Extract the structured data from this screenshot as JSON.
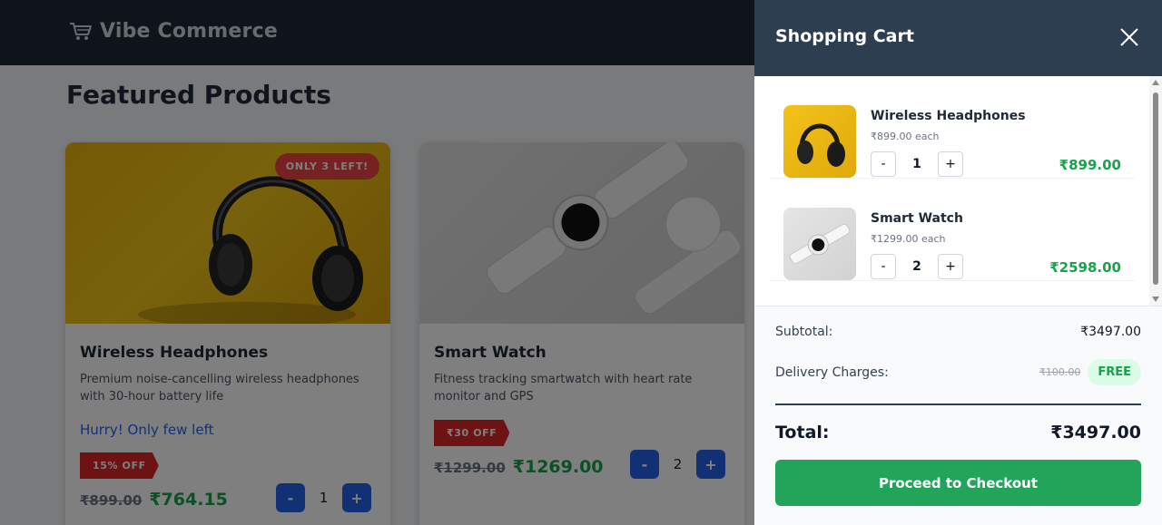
{
  "header": {
    "brand_icon": "cart-icon",
    "brand_name": "Vibe Commerce"
  },
  "main": {
    "title": "Featured Products",
    "products": [
      {
        "name": "Wireless Headphones",
        "description": "Premium noise-cancelling wireless headphones with 30-hour battery life",
        "stock_badge": "ONLY 3 LEFT!",
        "hurry": "Hurry! Only few left",
        "discount": "15% OFF",
        "old_price": "₹899.00",
        "new_price": "₹764.15",
        "qty": "1",
        "minus": "-",
        "plus": "+"
      },
      {
        "name": "Smart Watch",
        "description": "Fitness tracking smartwatch with heart rate monitor and GPS",
        "discount": "₹30 OFF",
        "old_price": "₹1299.00",
        "new_price": "₹1269.00",
        "qty": "2",
        "minus": "-",
        "plus": "+"
      }
    ]
  },
  "cart": {
    "title": "Shopping Cart",
    "close_icon": "close-icon",
    "items": [
      {
        "name": "Wireless Headphones",
        "each": "₹899.00 each",
        "qty": "1",
        "total": "₹899.00",
        "minus": "-",
        "plus": "+"
      },
      {
        "name": "Smart Watch",
        "each": "₹1299.00 each",
        "qty": "2",
        "total": "₹2598.00",
        "minus": "-",
        "plus": "+"
      }
    ],
    "summary": {
      "subtotal_label": "Subtotal:",
      "subtotal_value": "₹3497.00",
      "delivery_label": "Delivery Charges:",
      "delivery_old": "₹100.00",
      "delivery_value": "FREE",
      "total_label": "Total:",
      "total_value": "₹3497.00"
    },
    "checkout_label": "Proceed to Checkout"
  },
  "colors": {
    "header_bg": "#1f2937",
    "cart_header_bg": "#2d3e50",
    "price_green": "#16a34a",
    "checkout_green": "#22a55a",
    "accent_blue": "#2563eb",
    "discount_red": "#dc2626"
  }
}
